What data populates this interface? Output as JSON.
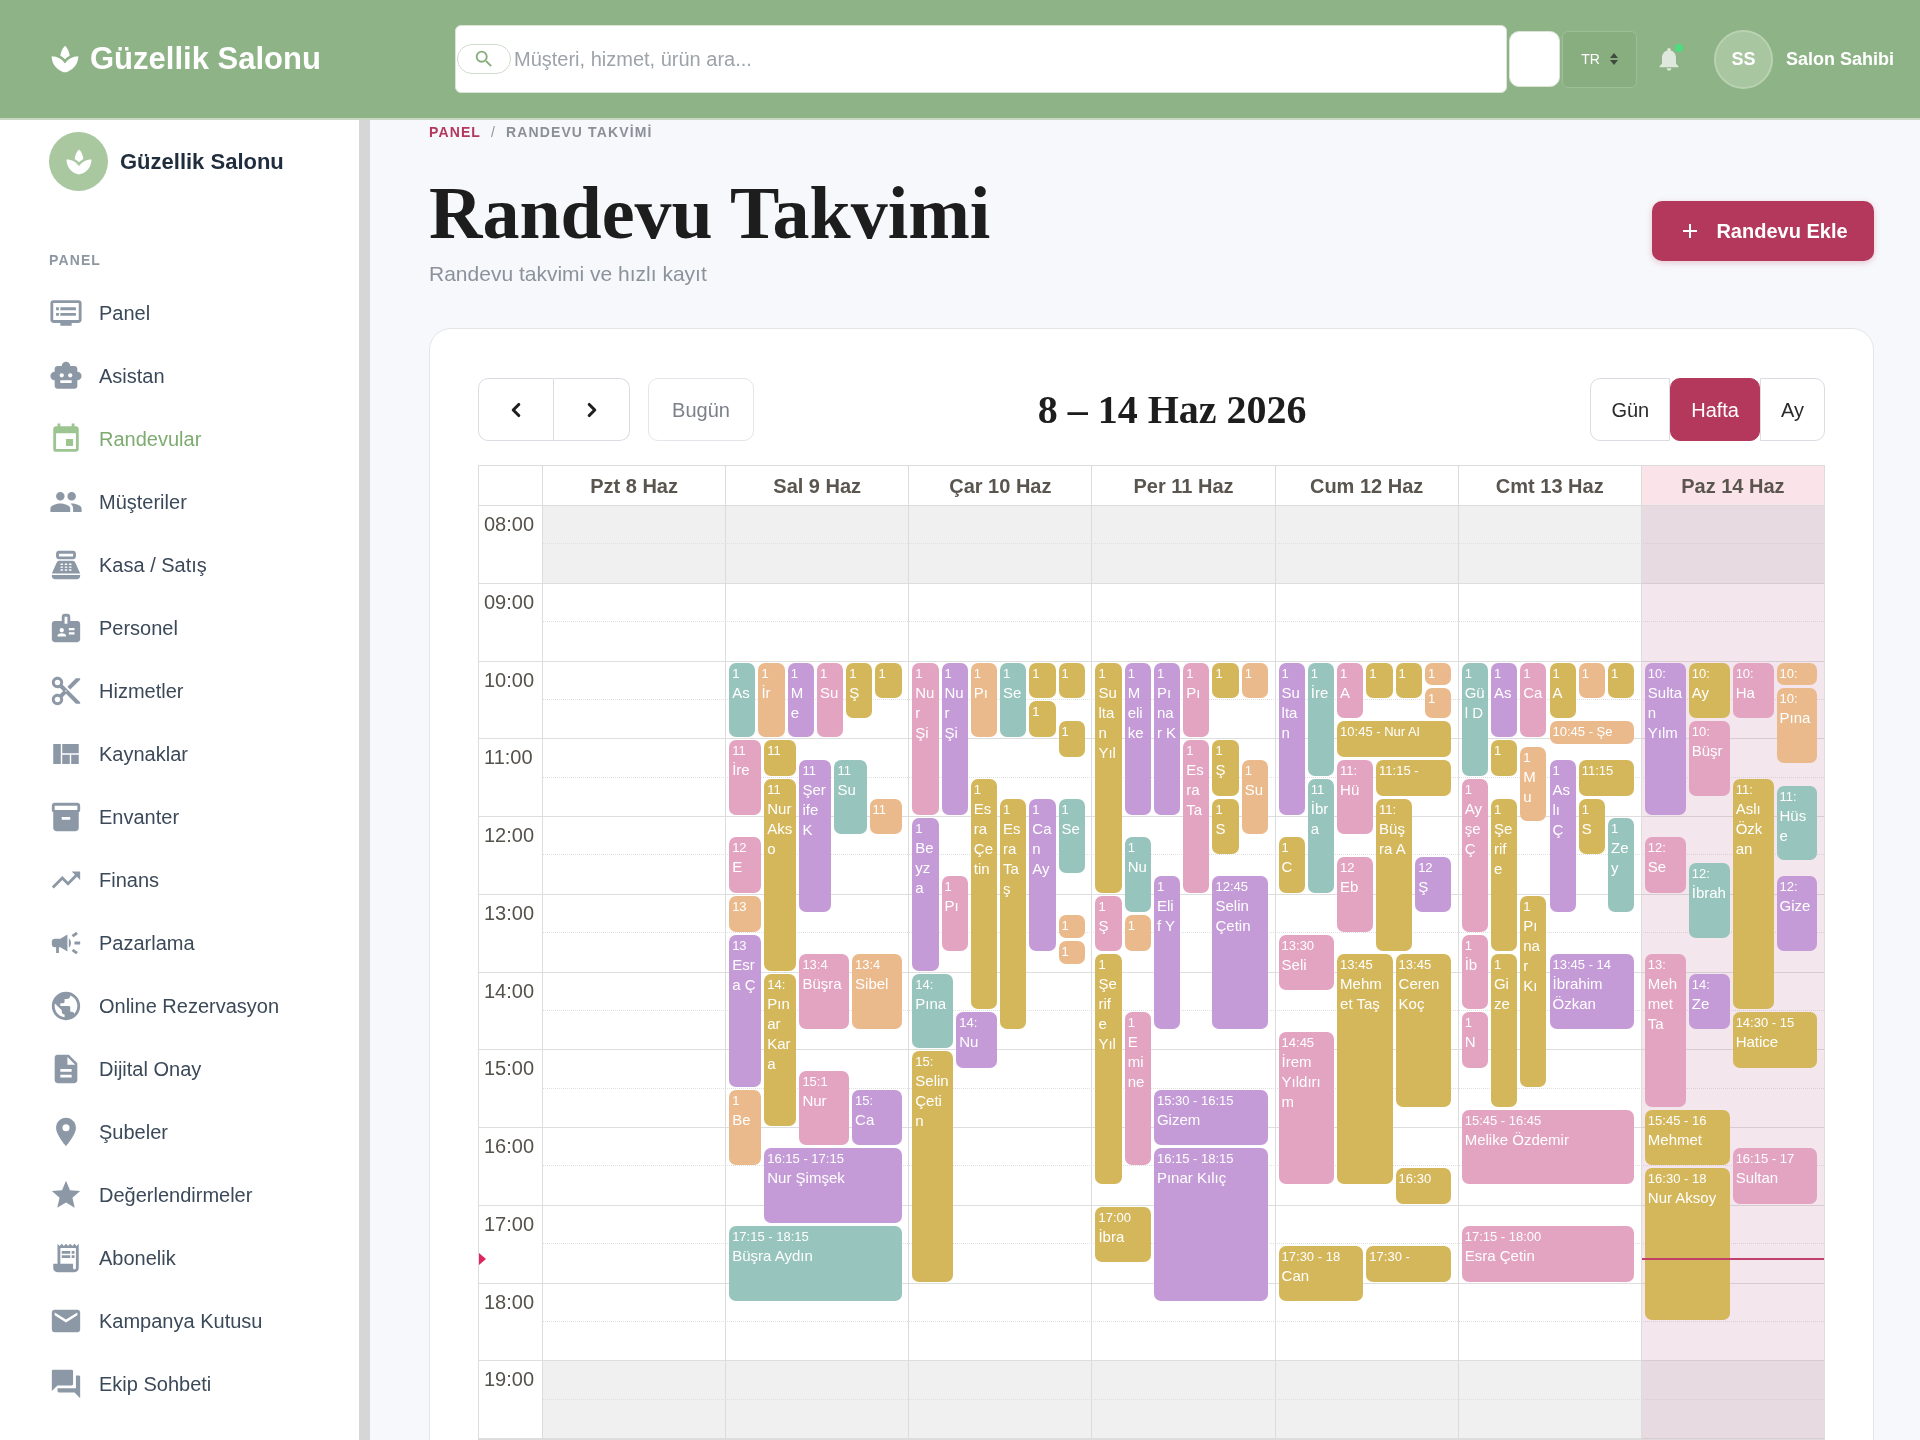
{
  "topbar": {
    "brand": "Güzellik Salonu",
    "search": {
      "placeholder": "Müşteri, hizmet, ürün ara..."
    },
    "language": "TR",
    "notifications": {
      "unread": true
    },
    "user": {
      "initials": "SS",
      "name": "Salon Sahibi"
    }
  },
  "sidebar": {
    "brand": "Güzellik Salonu",
    "section": "PANEL",
    "items": [
      {
        "label": "Panel",
        "selected": false
      },
      {
        "label": "Asistan",
        "selected": false
      },
      {
        "label": "Randevular",
        "selected": true
      },
      {
        "label": "Müşteriler",
        "selected": false
      },
      {
        "label": "Kasa / Satış",
        "selected": false
      },
      {
        "label": "Personel",
        "selected": false
      },
      {
        "label": "Hizmetler",
        "selected": false
      },
      {
        "label": "Kaynaklar",
        "selected": false
      },
      {
        "label": "Envanter",
        "selected": false
      },
      {
        "label": "Finans",
        "selected": false
      },
      {
        "label": "Pazarlama",
        "selected": false
      },
      {
        "label": "Online Rezervasyon",
        "selected": false
      },
      {
        "label": "Dijital Onay",
        "selected": false
      },
      {
        "label": "Şubeler",
        "selected": false
      },
      {
        "label": "Değerlendirmeler",
        "selected": false
      },
      {
        "label": "Abonelik",
        "selected": false
      },
      {
        "label": "Kampanya Kutusu",
        "selected": false
      },
      {
        "label": "Ekip Sohbeti",
        "selected": false
      }
    ]
  },
  "breadcrumb": {
    "separator": "/",
    "items": [
      {
        "label": "PANEL",
        "current": false
      },
      {
        "label": "RANDEVU TAKVİMİ",
        "current": true
      }
    ]
  },
  "page": {
    "title": "Randevu Takvimi",
    "subtitle": "Randevu takvimi ve hızlı kayıt",
    "action": "Randevu Ekle"
  },
  "calendar": {
    "today_button": {
      "label": "Bugün",
      "disabled": true
    },
    "title": "8 – 14 Haz 2026",
    "views": [
      {
        "label": "Gün",
        "selected": false
      },
      {
        "label": "Hafta",
        "selected": true
      },
      {
        "label": "Ay",
        "selected": false
      }
    ],
    "hours": [
      {
        "label": "08:00",
        "closed": true
      },
      {
        "label": "09:00",
        "closed": false
      },
      {
        "label": "10:00",
        "closed": false
      },
      {
        "label": "11:00",
        "closed": false
      },
      {
        "label": "12:00",
        "closed": false
      },
      {
        "label": "13:00",
        "closed": false
      },
      {
        "label": "14:00",
        "closed": false
      },
      {
        "label": "15:00",
        "closed": false
      },
      {
        "label": "16:00",
        "closed": false
      },
      {
        "label": "17:00",
        "closed": false
      },
      {
        "label": "18:00",
        "closed": false
      },
      {
        "label": "19:00",
        "closed": true
      }
    ],
    "days": [
      {
        "label": "Pzt 8 Haz",
        "today": false
      },
      {
        "label": "Sal 9 Haz",
        "today": false,
        "events": [
          {
            "kind": "long",
            "color": "#97c4bc",
            "time": "1",
            "name": "As"
          },
          {
            "kind": "long",
            "color": "#eaba8c",
            "time": "1",
            "name": "İr"
          },
          {
            "kind": "long",
            "color": "#c49bd7",
            "time": "1",
            "name": "Me"
          },
          {
            "kind": "long",
            "color": "#e3a4c2",
            "time": "1",
            "name": "Su"
          },
          {
            "kind": "long",
            "color": "#d5b75b",
            "time": "1",
            "name": "Ş"
          },
          {
            "kind": "short",
            "color": "#d5b75b",
            "label": "1"
          },
          {
            "kind": "long",
            "color": "#e3a4c2",
            "time": "11",
            "name": "İre"
          },
          {
            "kind": "short",
            "color": "#d5b75b",
            "label": "11"
          },
          {
            "kind": "long",
            "color": "#c49bd7",
            "time": "11",
            "name": "Şerife K"
          },
          {
            "kind": "long",
            "color": "#97c4bc",
            "time": "11",
            "name": "Su"
          },
          {
            "kind": "long",
            "color": "#d5b75b",
            "time": "11",
            "name": "Nur Akso"
          },
          {
            "kind": "short",
            "color": "#eaba8c",
            "label": "11"
          },
          {
            "kind": "long",
            "color": "#e3a4c2",
            "time": "12",
            "name": "E"
          },
          {
            "kind": "short",
            "color": "#eaba8c",
            "label": "13"
          },
          {
            "kind": "long",
            "color": "#c49bd7",
            "time": "13",
            "name": "Esra Ç"
          },
          {
            "kind": "long",
            "color": "#e3a4c2",
            "time": "13:4",
            "name": "Büşra"
          },
          {
            "kind": "long",
            "color": "#eaba8c",
            "time": "13:4",
            "name": "Sibel"
          },
          {
            "kind": "long",
            "color": "#d5b75b",
            "time": "14:",
            "name": "Pınar Kara"
          },
          {
            "kind": "long",
            "color": "#e3a4c2",
            "time": "15:1",
            "name": "Nur"
          },
          {
            "kind": "long",
            "color": "#eaba8c",
            "time": "1",
            "name": "Be"
          },
          {
            "kind": "long",
            "color": "#c49bd7",
            "time": "15:",
            "name": "Ca"
          },
          {
            "kind": "long",
            "color": "#c49bd7",
            "time": "16:15 - 17:15",
            "name": "Nur Şimşek"
          },
          {
            "kind": "long",
            "color": "#97c4bc",
            "time": "17:15 - 18:15",
            "name": "Büşra Aydın"
          }
        ]
      },
      {
        "label": "Çar 10 Haz",
        "today": false,
        "events": [
          {
            "kind": "long",
            "color": "#e3a4c2",
            "time": "1",
            "name": "Nur Şi"
          },
          {
            "kind": "long",
            "color": "#c49bd7",
            "time": "1",
            "name": "Nur Şi"
          },
          {
            "kind": "long",
            "color": "#eaba8c",
            "time": "1",
            "name": "Pı"
          },
          {
            "kind": "long",
            "color": "#97c4bc",
            "time": "1",
            "name": "Se"
          },
          {
            "kind": "short",
            "color": "#d5b75b",
            "label": "1"
          },
          {
            "kind": "short",
            "color": "#d5b75b",
            "label": "1"
          },
          {
            "kind": "short",
            "color": "#d5b75b",
            "label": "1"
          },
          {
            "kind": "short",
            "color": "#d5b75b",
            "label": "1"
          },
          {
            "kind": "long",
            "color": "#d5b75b",
            "time": "1",
            "name": "Esra Çetin"
          },
          {
            "kind": "long",
            "color": "#d5b75b",
            "time": "1",
            "name": "Esra Taş"
          },
          {
            "kind": "long",
            "color": "#c49bd7",
            "time": "1",
            "name": "Can Ay"
          },
          {
            "kind": "long",
            "color": "#97c4bc",
            "time": "1",
            "name": "Se"
          },
          {
            "kind": "long",
            "color": "#c49bd7",
            "time": "1",
            "name": "Beyza"
          },
          {
            "kind": "long",
            "color": "#e3a4c2",
            "time": "1",
            "name": "Pı"
          },
          {
            "kind": "short",
            "color": "#eaba8c",
            "label": "1"
          },
          {
            "kind": "short",
            "color": "#eaba8c",
            "label": "1"
          },
          {
            "kind": "long",
            "color": "#97c4bc",
            "time": "14:",
            "name": "Pına"
          },
          {
            "kind": "long",
            "color": "#c49bd7",
            "time": "14:",
            "name": "Nu"
          },
          {
            "kind": "long",
            "color": "#d5b75b",
            "time": "15:",
            "name": "Selin Çetin"
          }
        ]
      },
      {
        "label": "Per 11 Haz",
        "today": false,
        "events": [
          {
            "kind": "long",
            "color": "#d5b75b",
            "time": "1",
            "name": "Sultan Yıl"
          },
          {
            "kind": "long",
            "color": "#c49bd7",
            "time": "1",
            "name": "Melike"
          },
          {
            "kind": "long",
            "color": "#c49bd7",
            "time": "1",
            "name": "Pınar K"
          },
          {
            "kind": "long",
            "color": "#e3a4c2",
            "time": "1",
            "name": "Pı"
          },
          {
            "kind": "short",
            "color": "#d5b75b",
            "label": "1"
          },
          {
            "kind": "short",
            "color": "#eaba8c",
            "label": "1"
          },
          {
            "kind": "long",
            "color": "#e3a4c2",
            "time": "1",
            "name": "Esra Ta"
          },
          {
            "kind": "long",
            "color": "#d5b75b",
            "time": "1",
            "name": "Ş"
          },
          {
            "kind": "long",
            "color": "#eaba8c",
            "time": "1",
            "name": "Su"
          },
          {
            "kind": "long",
            "color": "#d5b75b",
            "time": "1",
            "name": "S"
          },
          {
            "kind": "long",
            "color": "#97c4bc",
            "time": "1",
            "name": "Nu"
          },
          {
            "kind": "long",
            "color": "#e3a4c2",
            "time": "1",
            "name": "Ş"
          },
          {
            "kind": "short",
            "color": "#eaba8c",
            "label": "1"
          },
          {
            "kind": "long",
            "color": "#c49bd7",
            "time": "1",
            "name": "Elif Y"
          },
          {
            "kind": "long",
            "color": "#c49bd7",
            "time": "12:45",
            "name": "Selin Çetin"
          },
          {
            "kind": "long",
            "color": "#d5b75b",
            "time": "1",
            "name": "Şerife Yıl"
          },
          {
            "kind": "long",
            "color": "#e3a4c2",
            "time": "1",
            "name": "Emine"
          },
          {
            "kind": "long",
            "color": "#c49bd7",
            "time": "15:30 - 16:15",
            "name": "Gizem"
          },
          {
            "kind": "long",
            "color": "#c49bd7",
            "time": "16:15 - 18:15",
            "name": "Pınar Kılıç"
          },
          {
            "kind": "long",
            "color": "#d5b75b",
            "time": "17:00",
            "name": "İbra"
          }
        ]
      },
      {
        "label": "Cum 12 Haz",
        "today": false,
        "events": [
          {
            "kind": "long",
            "color": "#c49bd7",
            "time": "1",
            "name": "Sultan"
          },
          {
            "kind": "long",
            "color": "#97c4bc",
            "time": "1",
            "name": "İre"
          },
          {
            "kind": "long",
            "color": "#e3a4c2",
            "time": "1",
            "name": "A"
          },
          {
            "kind": "short",
            "color": "#d5b75b",
            "label": "1"
          },
          {
            "kind": "short",
            "color": "#d5b75b",
            "label": "1"
          },
          {
            "kind": "short",
            "color": "#eaba8c",
            "label": "1"
          },
          {
            "kind": "short",
            "color": "#eaba8c",
            "label": "1"
          },
          {
            "kind": "short",
            "color": "#d5b75b",
            "label": "10:45 - Nur Al"
          },
          {
            "kind": "long",
            "color": "#e3a4c2",
            "time": "11:",
            "name": "Hü"
          },
          {
            "kind": "short",
            "color": "#d5b75b",
            "label": "11:15 -"
          },
          {
            "kind": "long",
            "color": "#97c4bc",
            "time": "11",
            "name": "İbra"
          },
          {
            "kind": "long",
            "color": "#d5b75b",
            "time": "11:",
            "name": "Büşra A"
          },
          {
            "kind": "long",
            "color": "#d5b75b",
            "time": "1",
            "name": "C"
          },
          {
            "kind": "long",
            "color": "#e3a4c2",
            "time": "12",
            "name": "Eb"
          },
          {
            "kind": "long",
            "color": "#c49bd7",
            "time": "12",
            "name": "Ş"
          },
          {
            "kind": "long",
            "color": "#e3a4c2",
            "time": "13:30",
            "name": "Seli"
          },
          {
            "kind": "long",
            "color": "#d5b75b",
            "time": "13:45",
            "name": "Mehmet Taş"
          },
          {
            "kind": "long",
            "color": "#d5b75b",
            "time": "13:45",
            "name": "Ceren Koç"
          },
          {
            "kind": "long",
            "color": "#e3a4c2",
            "time": "14:45",
            "name": "İrem Yıldırım"
          },
          {
            "kind": "short",
            "color": "#d5b75b",
            "label": "16:30"
          },
          {
            "kind": "long",
            "color": "#d5b75b",
            "time": "17:30 - 18",
            "name": "Can"
          },
          {
            "kind": "short",
            "color": "#d5b75b",
            "label": "17:30 -"
          }
        ]
      },
      {
        "label": "Cmt 13 Haz",
        "today": false,
        "events": [
          {
            "kind": "long",
            "color": "#97c4bc",
            "time": "1",
            "name": "Gül D"
          },
          {
            "kind": "long",
            "color": "#c49bd7",
            "time": "1",
            "name": "As"
          },
          {
            "kind": "long",
            "color": "#e3a4c2",
            "time": "1",
            "name": "Ca"
          },
          {
            "kind": "long",
            "color": "#d5b75b",
            "time": "1",
            "name": "A"
          },
          {
            "kind": "short",
            "color": "#eaba8c",
            "label": "1"
          },
          {
            "kind": "short",
            "color": "#d5b75b",
            "label": "1"
          },
          {
            "kind": "short",
            "color": "#eaba8c",
            "label": "10:45 - Şe"
          },
          {
            "kind": "short",
            "color": "#d5b75b",
            "label": "1"
          },
          {
            "kind": "long",
            "color": "#eaba8c",
            "time": "1",
            "name": "Mu"
          },
          {
            "kind": "long",
            "color": "#c49bd7",
            "time": "1",
            "name": "Aslı Ç"
          },
          {
            "kind": "short",
            "color": "#d5b75b",
            "label": "11:15"
          },
          {
            "kind": "long",
            "color": "#e3a4c2",
            "time": "1",
            "name": "Ayşe Ç"
          },
          {
            "kind": "long",
            "color": "#d5b75b",
            "time": "1",
            "name": "Şerife"
          },
          {
            "kind": "long",
            "color": "#d5b75b",
            "time": "1",
            "name": "S"
          },
          {
            "kind": "long",
            "color": "#97c4bc",
            "time": "1",
            "name": "Zey"
          },
          {
            "kind": "long",
            "color": "#d5b75b",
            "time": "1",
            "name": "Pınar Kı"
          },
          {
            "kind": "long",
            "color": "#e3a4c2",
            "time": "1",
            "name": "İb"
          },
          {
            "kind": "long",
            "color": "#d5b75b",
            "time": "1",
            "name": "Gize"
          },
          {
            "kind": "long",
            "color": "#c49bd7",
            "time": "13:45 - 14",
            "name": "İbrahim Özkan"
          },
          {
            "kind": "long",
            "color": "#e3a4c2",
            "time": "1",
            "name": "N"
          },
          {
            "kind": "long",
            "color": "#e3a4c2",
            "time": "15:45 - 16:45",
            "name": "Melike Özdemir"
          },
          {
            "kind": "long",
            "color": "#e3a4c2",
            "time": "17:15 - 18:00",
            "name": "Esra Çetin"
          }
        ]
      },
      {
        "label": "Paz 14 Haz",
        "today": true,
        "events": [
          {
            "kind": "long",
            "color": "#c49bd7",
            "time": "10:",
            "name": "Sultan Yılm"
          },
          {
            "kind": "long",
            "color": "#d5b75b",
            "time": "10:",
            "name": "Ay"
          },
          {
            "kind": "long",
            "color": "#e3a4c2",
            "time": "10:",
            "name": "Ha"
          },
          {
            "kind": "short",
            "color": "#eaba8c",
            "label": "10:"
          },
          {
            "kind": "long",
            "color": "#eaba8c",
            "time": "10:",
            "name": "Pına"
          },
          {
            "kind": "long",
            "color": "#e3a4c2",
            "time": "10:",
            "name": "Büşr"
          },
          {
            "kind": "long",
            "color": "#d5b75b",
            "time": "11:",
            "name": "Aslı Özkan"
          },
          {
            "kind": "long",
            "color": "#97c4bc",
            "time": "11:",
            "name": "Hüse"
          },
          {
            "kind": "long",
            "color": "#e3a4c2",
            "time": "12:",
            "name": "Se"
          },
          {
            "kind": "long",
            "color": "#97c4bc",
            "time": "12:",
            "name": "İbrah"
          },
          {
            "kind": "long",
            "color": "#c49bd7",
            "time": "12:",
            "name": "Gize"
          },
          {
            "kind": "long",
            "color": "#e3a4c2",
            "time": "13:",
            "name": "Mehmet Ta"
          },
          {
            "kind": "long",
            "color": "#c49bd7",
            "time": "14:",
            "name": "Ze"
          },
          {
            "kind": "long",
            "color": "#d5b75b",
            "time": "14:30 - 15",
            "name": "Hatice"
          },
          {
            "kind": "long",
            "color": "#d5b75b",
            "time": "15:45 - 16",
            "name": "Mehmet"
          },
          {
            "kind": "long",
            "color": "#e3a4c2",
            "time": "16:15 - 17",
            "name": "Sultan"
          },
          {
            "kind": "long",
            "color": "#d5b75b",
            "time": "16:30 - 18",
            "name": "Nur Aksoy"
          }
        ]
      }
    ]
  }
}
